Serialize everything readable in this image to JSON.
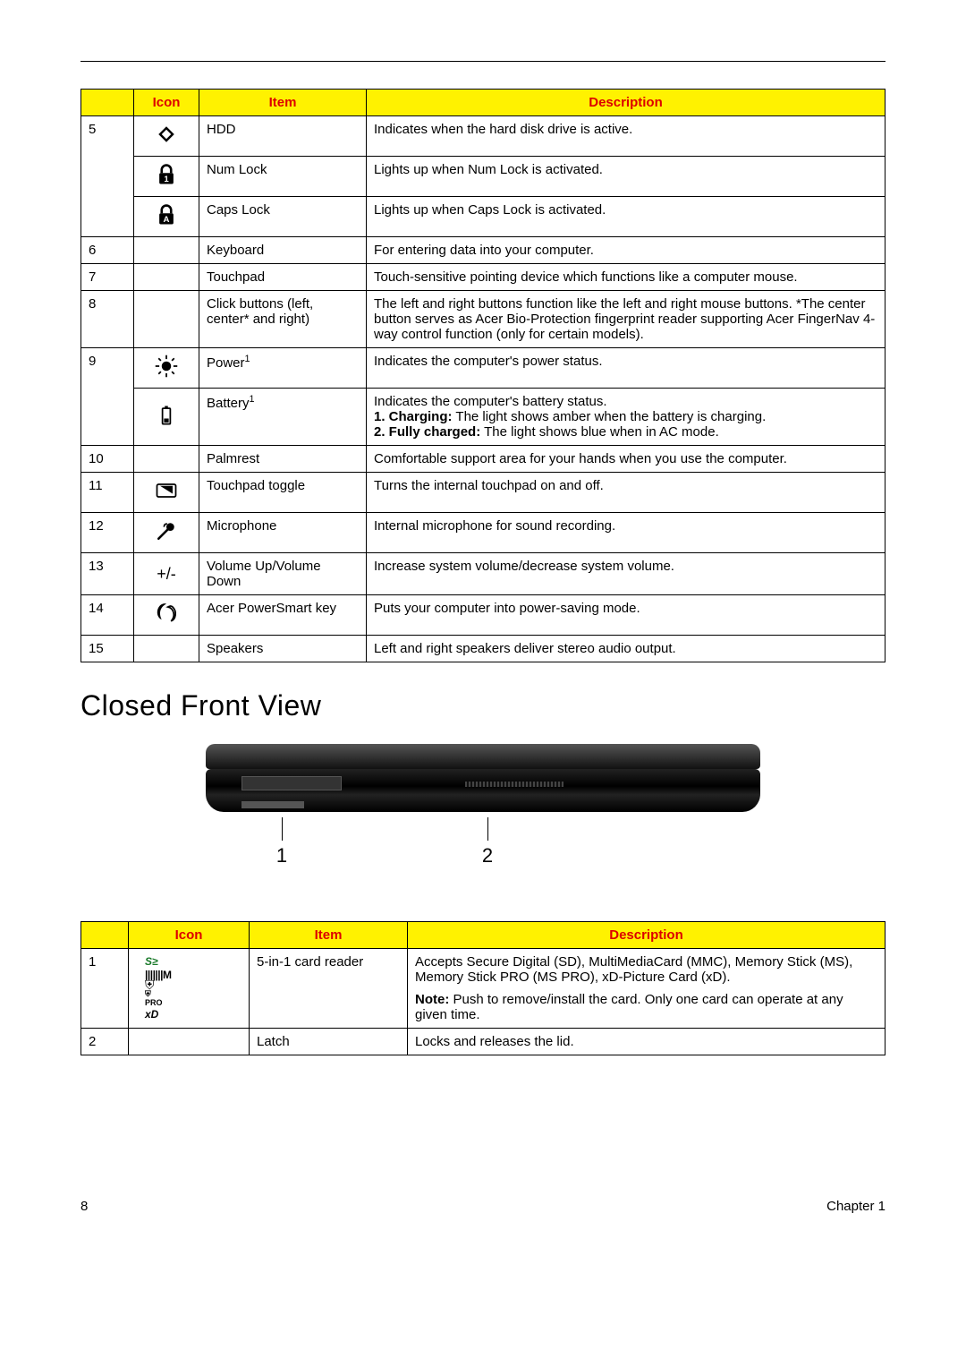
{
  "table1": {
    "headers": {
      "icon": "Icon",
      "item": "Item",
      "description": "Description"
    },
    "rows": [
      {
        "num": "5",
        "icon": "hdd",
        "item": "HDD",
        "desc": "Indicates when the hard disk drive is active."
      },
      {
        "num": "",
        "icon": "numlock",
        "item": "Num Lock",
        "desc": "Lights up when Num Lock is activated."
      },
      {
        "num": "",
        "icon": "capslock",
        "item": "Caps Lock",
        "desc": "Lights up when Caps Lock is activated."
      },
      {
        "num": "6",
        "icon": "",
        "item": "Keyboard",
        "desc": "For entering data into your computer."
      },
      {
        "num": "7",
        "icon": "",
        "item": "Touchpad",
        "desc": "Touch-sensitive pointing device which functions like a computer mouse."
      },
      {
        "num": "8",
        "icon": "",
        "item": "Click buttons (left, center* and right)",
        "desc": "The left and right buttons function like the left and right mouse buttons. *The center button serves as Acer Bio-Protection fingerprint reader supporting Acer FingerNav 4-way control function (only for certain models)."
      },
      {
        "num": "9",
        "icon": "power",
        "item_html": "Power",
        "sup": "1",
        "desc": "Indicates the computer's power status."
      },
      {
        "num": "",
        "icon": "battery",
        "item_html": "Battery",
        "sup": "1",
        "desc_html": {
          "line0": "Indicates the computer's battery status.",
          "b1": "1. Charging:",
          "t1": " The light shows amber when the battery is charging.",
          "b2": "2. Fully charged:",
          "t2": " The light shows blue when in AC mode."
        }
      },
      {
        "num": "10",
        "icon": "",
        "item": "Palmrest",
        "desc": "Comfortable support area for your hands when you use the computer."
      },
      {
        "num": "11",
        "icon": "touchpad-toggle",
        "item": "Touchpad toggle",
        "desc": "Turns the internal touchpad on and off."
      },
      {
        "num": "12",
        "icon": "mic",
        "item": "Microphone",
        "desc": "Internal microphone for sound recording."
      },
      {
        "num": "13",
        "icon_text": "+/-",
        "item": "Volume Up/Volume Down",
        "desc": "Increase system volume/decrease system volume."
      },
      {
        "num": "14",
        "icon": "powersmart",
        "item": "Acer PowerSmart key",
        "desc": "Puts your computer into power-saving mode."
      },
      {
        "num": "15",
        "icon": "",
        "item": "Speakers",
        "desc": "Left and right speakers deliver stereo audio output."
      }
    ]
  },
  "section_heading": "Closed Front View",
  "callouts": {
    "c1": "1",
    "c2": "2"
  },
  "table2": {
    "headers": {
      "icon": "Icon",
      "item": "Item",
      "description": "Description"
    },
    "rows": [
      {
        "num": "1",
        "icon": "card-logos",
        "item": "5-in-1 card reader",
        "desc_main": "Accepts Secure Digital (SD), MultiMediaCard (MMC), Memory Stick (MS), Memory Stick PRO (MS PRO), xD-Picture Card (xD).",
        "note_label": "Note:",
        "note_text": " Push to remove/install the card. Only one card can operate at any given time."
      },
      {
        "num": "2",
        "icon": "",
        "item": "Latch",
        "desc": "Locks and releases the lid."
      }
    ]
  },
  "card_logos": {
    "sd": "S≥",
    "mmc": "|||||||M",
    "ms_pro": "PRO",
    "xd": "xD"
  },
  "footer": {
    "page": "8",
    "chapter": "Chapter 1"
  }
}
